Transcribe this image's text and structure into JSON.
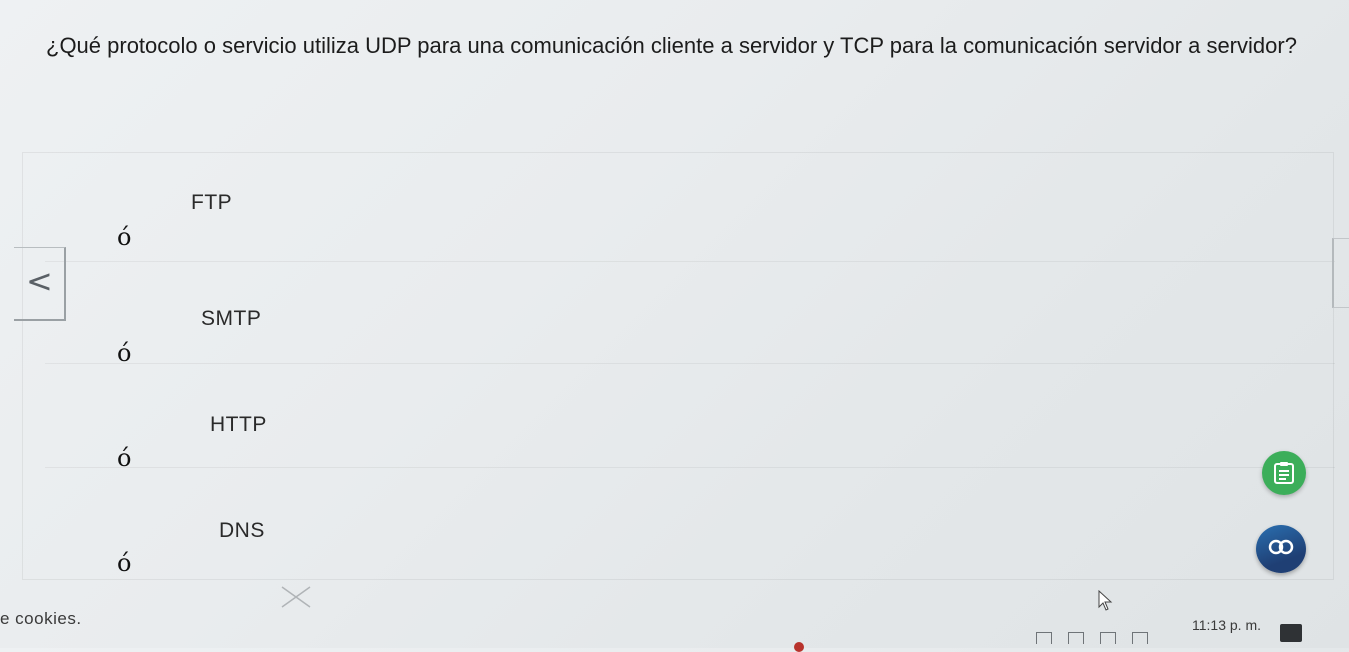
{
  "question": {
    "text": "¿Qué protocolo o servicio utiliza UDP para una comunicación cliente a servidor y TCP para la comunicación servidor a servidor?"
  },
  "options": [
    {
      "label": "FTP",
      "marker": "ó"
    },
    {
      "label": "SMTP",
      "marker": "ó"
    },
    {
      "label": "HTTP",
      "marker": "ó"
    },
    {
      "label": "DNS",
      "marker": "ó"
    }
  ],
  "navigation": {
    "prev_symbol": "<"
  },
  "footer": {
    "cookies_text": "e cookies."
  },
  "taskbar": {
    "clock": "11:13 p. m."
  },
  "icons": {
    "notes": "notes-icon",
    "assistant": "assistant-icon",
    "close": "close-icon",
    "cursor": "mouse-cursor-icon"
  },
  "colors": {
    "notes_button": "#3cae5a",
    "assistant_button": "#2a6fb0",
    "background": "#e9ecee"
  }
}
